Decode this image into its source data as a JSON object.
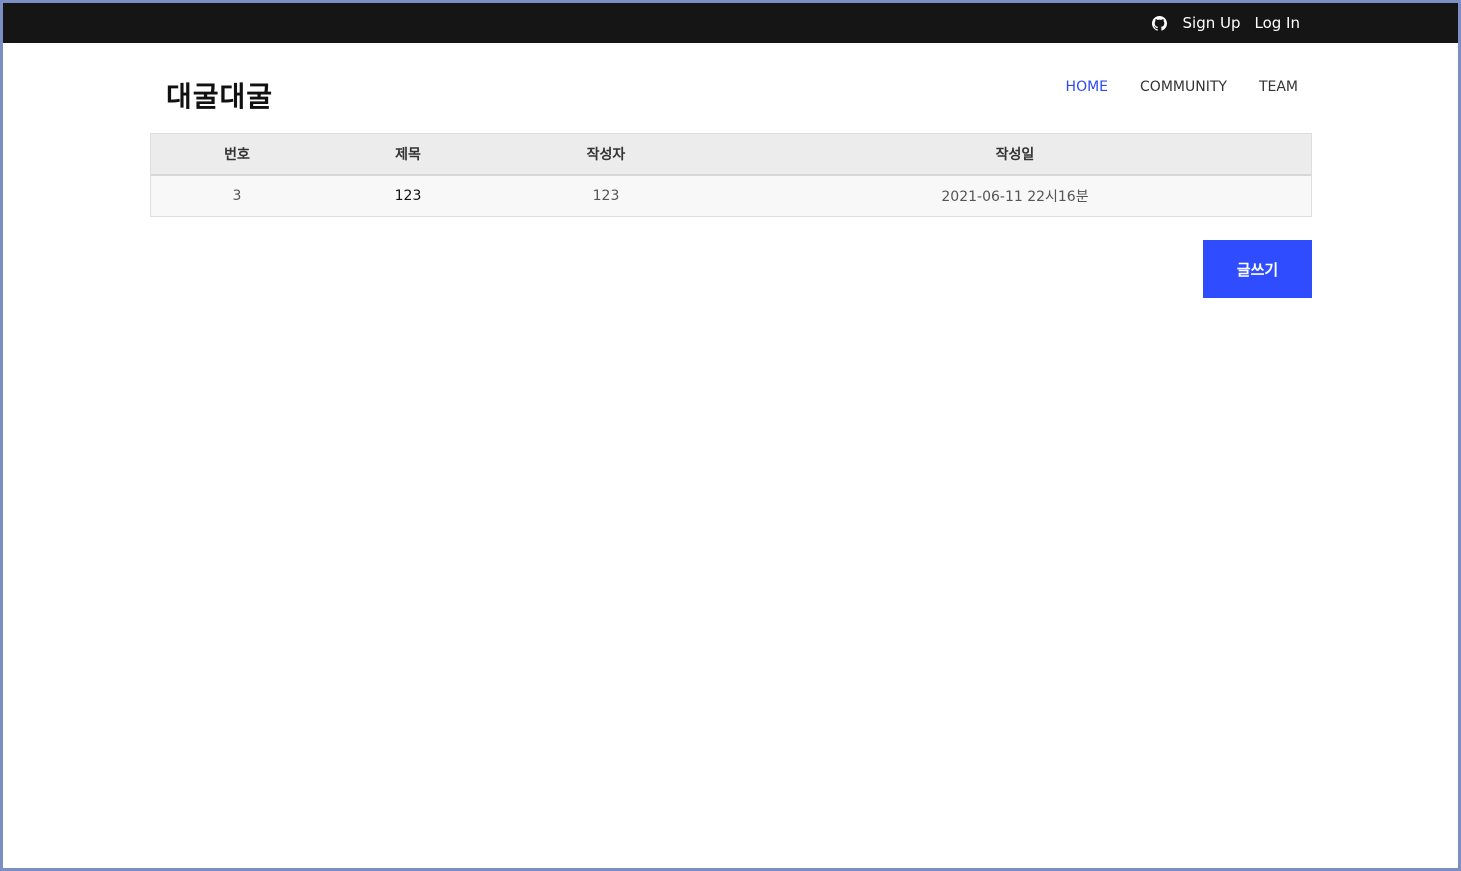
{
  "topbar": {
    "icon": "github-icon",
    "signup_label": "Sign Up",
    "login_label": "Log In"
  },
  "header": {
    "logo": "대굴대굴",
    "nav": [
      {
        "label": "HOME",
        "active": true
      },
      {
        "label": "COMMUNITY",
        "active": false
      },
      {
        "label": "TEAM",
        "active": false
      }
    ]
  },
  "board": {
    "columns": [
      "번호",
      "제목",
      "작성자",
      "작성일"
    ],
    "rows": [
      [
        "3",
        "123",
        "123",
        "2021-06-11 22시16분"
      ]
    ]
  },
  "actions": {
    "write_label": "글쓰기"
  },
  "colors": {
    "accent": "#2f4dff",
    "nav_active": "#2c4bf0",
    "topbar_bg": "#151515"
  }
}
